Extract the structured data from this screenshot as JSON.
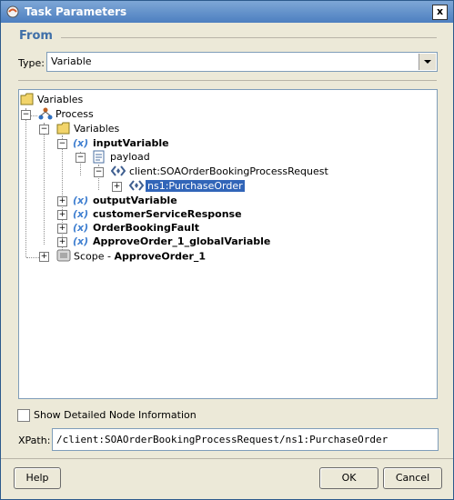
{
  "window": {
    "title": "Task Parameters",
    "close_glyph": "x"
  },
  "section": {
    "title": "From"
  },
  "type_field": {
    "label": "Type:",
    "value": "Variable"
  },
  "tree": {
    "root_label": "Variables",
    "process_label": "Process",
    "variables_label": "Variables",
    "input_variable": "inputVariable",
    "payload": "payload",
    "request": "client:SOAOrderBookingProcessRequest",
    "purchase_order": "ns1:PurchaseOrder",
    "output_variable": "outputVariable",
    "customer_service_response": "customerServiceResponse",
    "order_booking_fault": "OrderBookingFault",
    "approve_global": "ApproveOrder_1_globalVariable",
    "scope_prefix": "Scope - ",
    "scope_name": "ApproveOrder_1",
    "var_glyph": "(x)",
    "expand_plus": "+",
    "expand_minus": "−"
  },
  "options": {
    "show_detailed_label": "Show Detailed Node Information",
    "checked": false
  },
  "xpath": {
    "label": "XPath:",
    "value": "/client:SOAOrderBookingProcessRequest/ns1:PurchaseOrder"
  },
  "buttons": {
    "help": "Help",
    "ok": "OK",
    "cancel": "Cancel"
  },
  "colors": {
    "accent": "#3f6fa8",
    "selection": "#3165b8",
    "titlebar": "#4d7fc0"
  }
}
